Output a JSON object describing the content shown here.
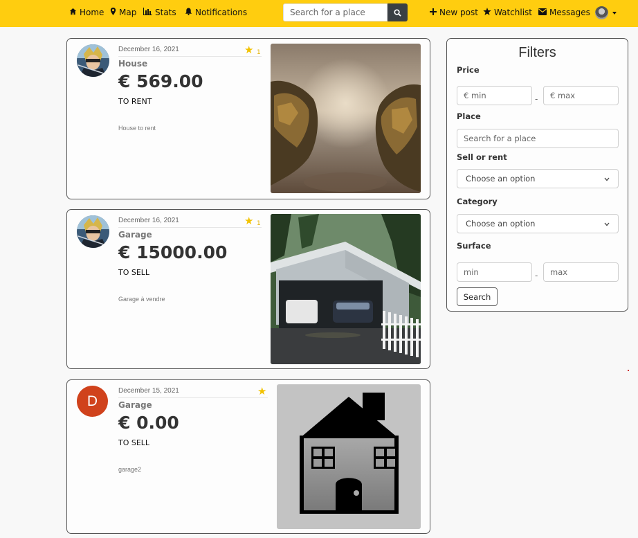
{
  "navbar": {
    "items": [
      {
        "icon": "home-icon",
        "label": "Home"
      },
      {
        "icon": "map-marker-icon",
        "label": "Map"
      },
      {
        "icon": "bar-chart-icon",
        "label": "Stats"
      },
      {
        "icon": "bell-icon",
        "label": "Notifications"
      }
    ],
    "search_placeholder": "Search for a place",
    "right_items": [
      {
        "icon": "plus-icon",
        "label": "New post"
      },
      {
        "icon": "star-icon",
        "label": "Watchlist"
      },
      {
        "icon": "envelope-icon",
        "label": "Messages"
      }
    ],
    "accent_color": "#ffcd0f"
  },
  "posts": [
    {
      "date": "December 16, 2021",
      "category": "House",
      "price": "€ 569.00",
      "type": "TO RENT",
      "description": "House to rent",
      "watch_count": "1",
      "avatar": "hero-avatar",
      "image": "armor-art"
    },
    {
      "date": "December 16, 2021",
      "category": "Garage",
      "price": "€ 15000.00",
      "type": "TO SELL",
      "description": "Garage à vendre",
      "watch_count": "1",
      "avatar": "hero-avatar",
      "image": "garage-photo"
    },
    {
      "date": "December 15, 2021",
      "category": "Garage",
      "price": "€ 0.00",
      "type": "TO SELL",
      "description": "garage2",
      "watch_count": "",
      "avatar_letter": "D",
      "image": "house-icon"
    }
  ],
  "filters": {
    "title": "Filters",
    "price_label": "Price",
    "price_min_placeholder": "€ min",
    "price_max_placeholder": "€ max",
    "place_label": "Place",
    "place_placeholder": "Search for a place",
    "sell_rent_label": "Sell or rent",
    "sell_rent_value": "Choose an option",
    "category_label": "Category",
    "category_value": "Choose an option",
    "surface_label": "Surface",
    "surface_min_placeholder": "min",
    "surface_max_placeholder": "max",
    "search_button": "Search",
    "separator": "-"
  }
}
